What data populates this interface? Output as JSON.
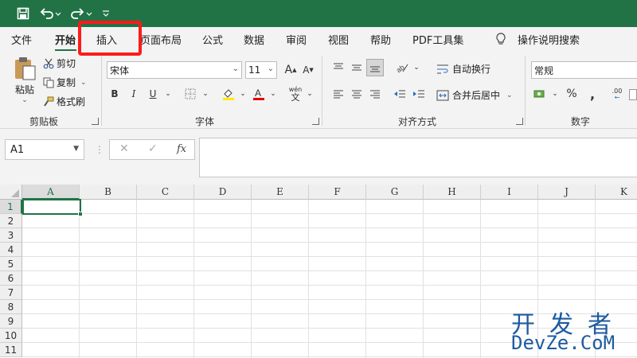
{
  "quick_access": {
    "save_icon": "save-icon",
    "undo_icon": "undo-icon",
    "redo_icon": "redo-icon",
    "customize_icon": "customize-icon"
  },
  "tabs": [
    {
      "label": "文件"
    },
    {
      "label": "开始"
    },
    {
      "label": "插入"
    },
    {
      "label": "页面布局"
    },
    {
      "label": "公式"
    },
    {
      "label": "数据"
    },
    {
      "label": "审阅"
    },
    {
      "label": "视图"
    },
    {
      "label": "帮助"
    },
    {
      "label": "PDF工具集"
    },
    {
      "label": "操作说明搜索"
    }
  ],
  "ribbon": {
    "clipboard": {
      "paste": "粘贴",
      "cut": "剪切",
      "copy": "复制",
      "format_painter": "格式刷",
      "group": "剪贴板"
    },
    "font": {
      "family": "宋体",
      "size": "11",
      "bold": "B",
      "italic": "I",
      "underline": "U",
      "phonetic": "wén",
      "phonetic_char": "文",
      "group": "字体"
    },
    "alignment": {
      "wrap_text": "自动换行",
      "merge_center": "合并后居中",
      "group": "对齐方式"
    },
    "number": {
      "format": "常规",
      "percent": "%",
      "comma": ",",
      "inc_decimal": ".00",
      "group": "数字"
    }
  },
  "formula_bar": {
    "name_box": "A1",
    "fx": "fx",
    "value": ""
  },
  "grid": {
    "columns": [
      "A",
      "B",
      "C",
      "D",
      "E",
      "F",
      "G",
      "H",
      "I",
      "J",
      "K"
    ],
    "rows": [
      "1",
      "2",
      "3",
      "4",
      "5",
      "6",
      "7",
      "8",
      "9",
      "10",
      "11"
    ],
    "active_cell": "A1"
  },
  "watermark": {
    "cn": "开发者",
    "en": "DevZe.CoM"
  },
  "colors": {
    "accent": "#217346",
    "highlight": "#ff1a1a",
    "watermark": "#1e5aa0"
  }
}
